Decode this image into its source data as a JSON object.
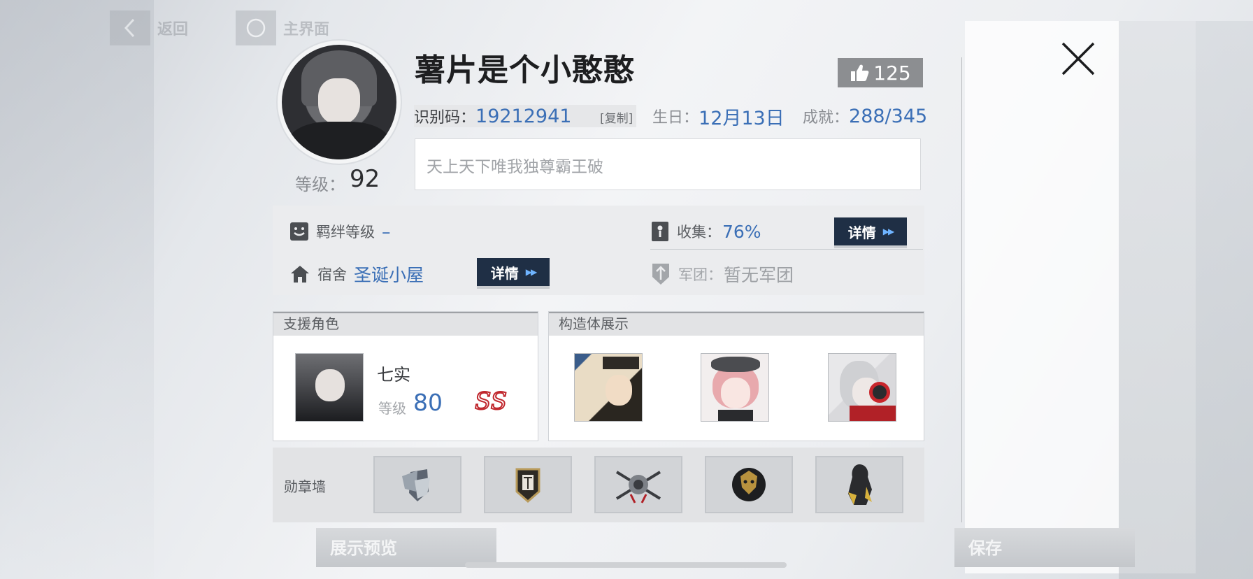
{
  "nav": {
    "back_label": "返回",
    "home_label": "主界面"
  },
  "profile": {
    "name": "薯片是个小憨憨",
    "likes": "125",
    "level_label": "等级：",
    "level_value": "92",
    "id_label": "识别码：",
    "id_value": "19212941",
    "copy_label": "[复制]",
    "birthday_label": "生日：",
    "birthday_value": "12月13日",
    "achievement_label": "成就：",
    "achievement_value": "288/345",
    "motto": "天上天下唯我独尊霸王破"
  },
  "info": {
    "bond_label": "羁绊等级",
    "bond_value": "–",
    "collection_label": "收集：",
    "collection_value": "76%",
    "dorm_label": "宿舍",
    "dorm_value": "圣诞小屋",
    "guild_label": "军团：",
    "guild_value": "暂无军团",
    "detail_label": "详情"
  },
  "support": {
    "title": "支援角色",
    "char_name": "七实",
    "level_label": "等级",
    "level_value": "80",
    "rank": "SS"
  },
  "showcase": {
    "title": "构造体展示"
  },
  "medals": {
    "title": "勋章墙"
  },
  "footer": {
    "preview_label": "展示预览",
    "save_label": "保存"
  },
  "colors": {
    "accent_blue": "#3b6fb6",
    "detail_btn": "#1f2f45",
    "rank_red": "#c0272d"
  },
  "icons": [
    "back-icon",
    "home-icon",
    "close-icon",
    "thumbs-up-icon",
    "bond-icon",
    "collection-icon",
    "dorm-icon",
    "guild-icon"
  ]
}
